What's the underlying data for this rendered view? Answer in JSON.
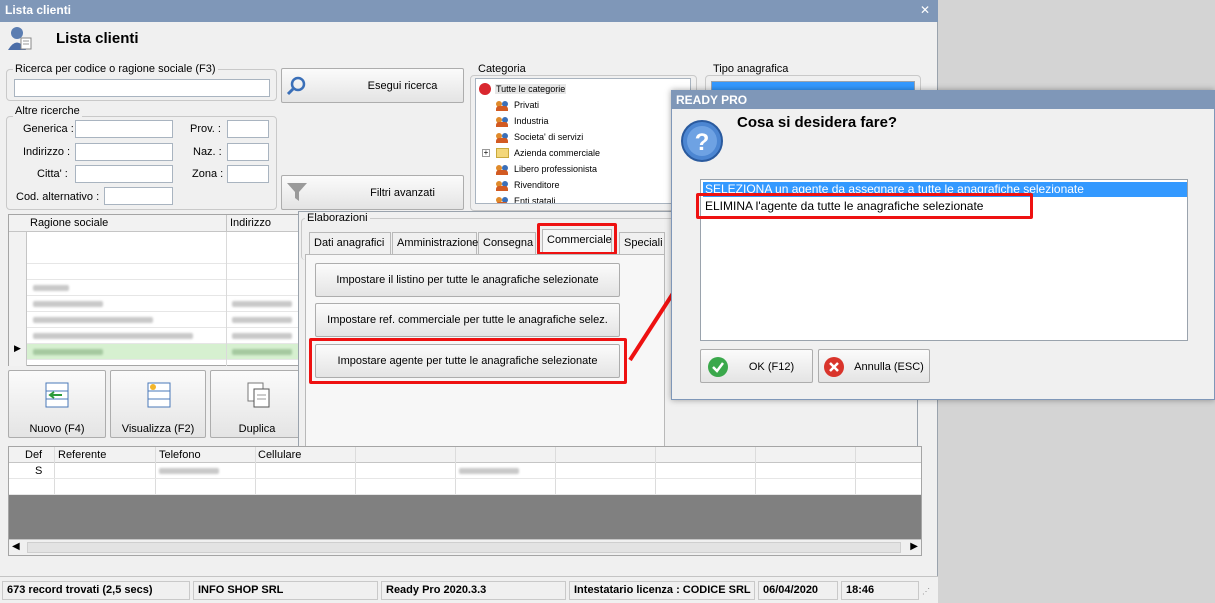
{
  "window": {
    "title": "Lista clienti",
    "header": "Lista clienti"
  },
  "search": {
    "group_label": "Ricerca per codice o ragione sociale (F3)",
    "query": "",
    "button": "Esegui ricerca",
    "advanced_button": "Filtri avanzati"
  },
  "altre": {
    "group_label": "Altre ricerche",
    "generica": "Generica :",
    "indirizzo": "Indirizzo :",
    "citta": "Citta' :",
    "cod_alt": "Cod. alternativo :",
    "prov": "Prov. :",
    "naz": "Naz. :",
    "zona": "Zona :"
  },
  "categoria": {
    "label": "Categoria",
    "items": [
      "Tutte le categorie",
      "Privati",
      "Industria",
      "Societa' di servizi",
      "Azienda commerciale",
      "Libero professionista",
      "Rivenditore",
      "Enti statali"
    ]
  },
  "tipo": {
    "label": "Tipo anagrafica"
  },
  "grid": {
    "col_ragione": "Ragione sociale",
    "col_indirizzo": "Indirizzo"
  },
  "elaborazioni": {
    "label": "Elaborazioni",
    "tabs": [
      "Dati anagrafici",
      "Amministrazione",
      "Consegna",
      "Commerciale",
      "Speciali"
    ],
    "buttons": [
      "Impostare il listino per tutte le anagrafiche selezionate",
      "Impostare ref. commerciale per tutte le anagrafiche selez.",
      "Impostare agente per tutte le anagrafiche selezionate"
    ]
  },
  "toolbar": {
    "nuovo": "Nuovo (F4)",
    "visualizza": "Visualizza (F2)",
    "duplica": "Duplica"
  },
  "contacts": {
    "col_def": "Def",
    "col_referente": "Referente",
    "col_telefono": "Telefono",
    "col_cellulare": "Cellulare",
    "row_def": "S"
  },
  "status": {
    "records": "673 record trovati (2,5 secs)",
    "company": "INFO SHOP SRL",
    "version": "Ready Pro 2020.3.3",
    "license": "Intestatario licenza : CODICE SRL",
    "date": "06/04/2020",
    "time": "18:46"
  },
  "dialog": {
    "title": "READY PRO",
    "question": "Cosa si desidera fare?",
    "options": [
      "SELEZIONA un agente da assegnare a tutte le anagrafiche selezionate",
      "ELIMINA l'agente da tutte le anagrafiche selezionate"
    ],
    "ok": "OK (F12)",
    "cancel": "Annulla (ESC)"
  },
  "colors": {
    "titlebar": "#7f97b8",
    "highlight": "#e11111",
    "selection": "#3399ff"
  }
}
